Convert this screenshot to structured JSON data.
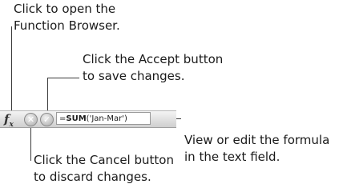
{
  "callouts": {
    "function_browser": [
      "Click to open the",
      "Function Browser."
    ],
    "accept": [
      "Click the Accept button",
      "to save changes."
    ],
    "formula": [
      "View or edit the formula",
      "in the text field."
    ],
    "cancel": [
      "Click the Cancel button",
      "to discard changes."
    ]
  },
  "formula_bar": {
    "fx_label": "f",
    "fx_sub": "x",
    "cancel_glyph": "✕",
    "accept_glyph": "✓",
    "formula_prefix": "=",
    "formula_func": "SUM",
    "formula_args": "('Jan-Mar')"
  }
}
